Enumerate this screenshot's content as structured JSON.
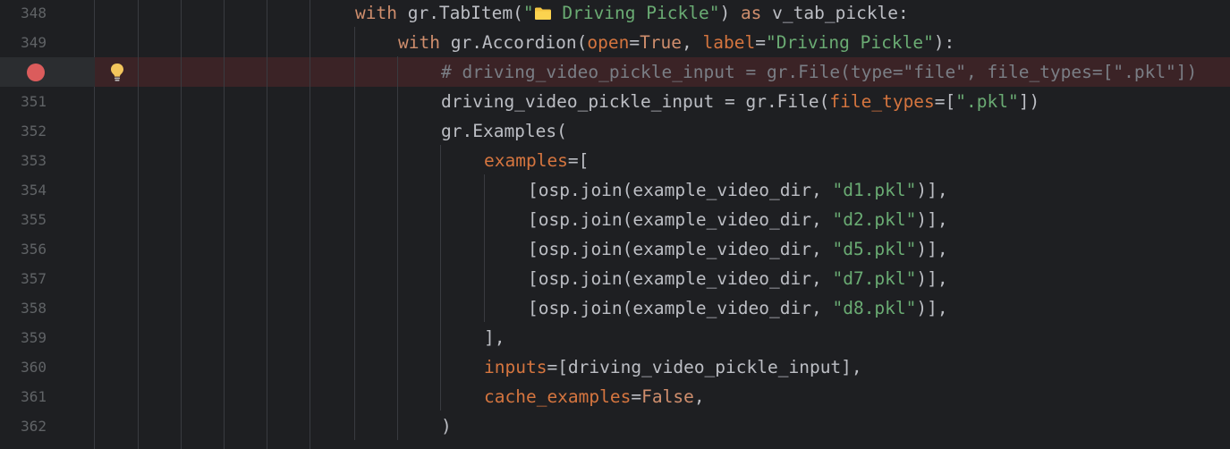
{
  "editor": {
    "line_numbers": [
      "348",
      "349",
      "350",
      "351",
      "352",
      "353",
      "354",
      "355",
      "356",
      "357",
      "358",
      "359",
      "360",
      "361",
      "362"
    ],
    "breakpoint_line": "350",
    "lines": [
      {
        "no": "348",
        "tokens": [
          {
            "t": "with",
            "c": "kw"
          },
          {
            "t": " gr.TabItem(",
            "c": "plain"
          },
          {
            "t": "\"",
            "c": "str"
          },
          {
            "t": "__FOLDER__",
            "c": "icon"
          },
          {
            "t": " Driving Pickle\"",
            "c": "str"
          },
          {
            "t": ") ",
            "c": "plain"
          },
          {
            "t": "as",
            "c": "kw"
          },
          {
            "t": " v_tab_pickle:",
            "c": "plain"
          }
        ]
      },
      {
        "no": "349",
        "tokens": [
          {
            "t": "with",
            "c": "kw"
          },
          {
            "t": " gr.Accordion(",
            "c": "plain"
          },
          {
            "t": "open",
            "c": "named"
          },
          {
            "t": "=",
            "c": "plain"
          },
          {
            "t": "True",
            "c": "kw"
          },
          {
            "t": ", ",
            "c": "plain"
          },
          {
            "t": "label",
            "c": "named"
          },
          {
            "t": "=",
            "c": "plain"
          },
          {
            "t": "\"Driving Pickle\"",
            "c": "str"
          },
          {
            "t": "):",
            "c": "plain"
          }
        ]
      },
      {
        "no": "350",
        "tokens": [
          {
            "t": "# driving_video_pickle_input = gr.File(type=\"file\", file_types=[\".pkl\"])",
            "c": "comment"
          }
        ]
      },
      {
        "no": "351",
        "tokens": [
          {
            "t": "driving_video_pickle_input = gr.File(",
            "c": "plain"
          },
          {
            "t": "file_types",
            "c": "named"
          },
          {
            "t": "=[",
            "c": "plain"
          },
          {
            "t": "\".pkl\"",
            "c": "str"
          },
          {
            "t": "])",
            "c": "plain"
          }
        ]
      },
      {
        "no": "352",
        "tokens": [
          {
            "t": "gr.Examples(",
            "c": "plain"
          }
        ]
      },
      {
        "no": "353",
        "tokens": [
          {
            "t": "examples",
            "c": "named"
          },
          {
            "t": "=[",
            "c": "plain"
          }
        ]
      },
      {
        "no": "354",
        "tokens": [
          {
            "t": "[osp.join(example_video_dir, ",
            "c": "plain"
          },
          {
            "t": "\"d1.pkl\"",
            "c": "str"
          },
          {
            "t": ")],",
            "c": "plain"
          }
        ]
      },
      {
        "no": "355",
        "tokens": [
          {
            "t": "[osp.join(example_video_dir, ",
            "c": "plain"
          },
          {
            "t": "\"d2.pkl\"",
            "c": "str"
          },
          {
            "t": ")],",
            "c": "plain"
          }
        ]
      },
      {
        "no": "356",
        "tokens": [
          {
            "t": "[osp.join(example_video_dir, ",
            "c": "plain"
          },
          {
            "t": "\"d5.pkl\"",
            "c": "str"
          },
          {
            "t": ")],",
            "c": "plain"
          }
        ]
      },
      {
        "no": "357",
        "tokens": [
          {
            "t": "[osp.join(example_video_dir, ",
            "c": "plain"
          },
          {
            "t": "\"d7.pkl\"",
            "c": "str"
          },
          {
            "t": ")],",
            "c": "plain"
          }
        ]
      },
      {
        "no": "358",
        "tokens": [
          {
            "t": "[osp.join(example_video_dir, ",
            "c": "plain"
          },
          {
            "t": "\"d8.pkl\"",
            "c": "str"
          },
          {
            "t": ")],",
            "c": "plain"
          }
        ]
      },
      {
        "no": "359",
        "tokens": [
          {
            "t": "],",
            "c": "plain"
          }
        ]
      },
      {
        "no": "360",
        "tokens": [
          {
            "t": "inputs",
            "c": "named"
          },
          {
            "t": "=[driving_video_pickle_input],",
            "c": "plain"
          }
        ]
      },
      {
        "no": "361",
        "tokens": [
          {
            "t": "cache_examples",
            "c": "named"
          },
          {
            "t": "=",
            "c": "plain"
          },
          {
            "t": "False",
            "c": "kw"
          },
          {
            "t": ",",
            "c": "plain"
          }
        ]
      },
      {
        "no": "362",
        "tokens": [
          {
            "t": ")",
            "c": "plain"
          }
        ]
      }
    ]
  },
  "icons": {
    "breakpoint": "breakpoint-icon",
    "intention": "lightbulb-icon",
    "folder": "folder-icon"
  },
  "colors": {
    "background": "#1e1f22",
    "breakpoint_line": "#3b2326",
    "keyword": "#cf8e6d",
    "string": "#6aab73",
    "named_arg": "#d5753f",
    "comment": "#7a7e85",
    "text": "#bcbec4",
    "line_number": "#606366",
    "breakpoint": "#db5c5c",
    "bulb": "#f2c55c"
  }
}
